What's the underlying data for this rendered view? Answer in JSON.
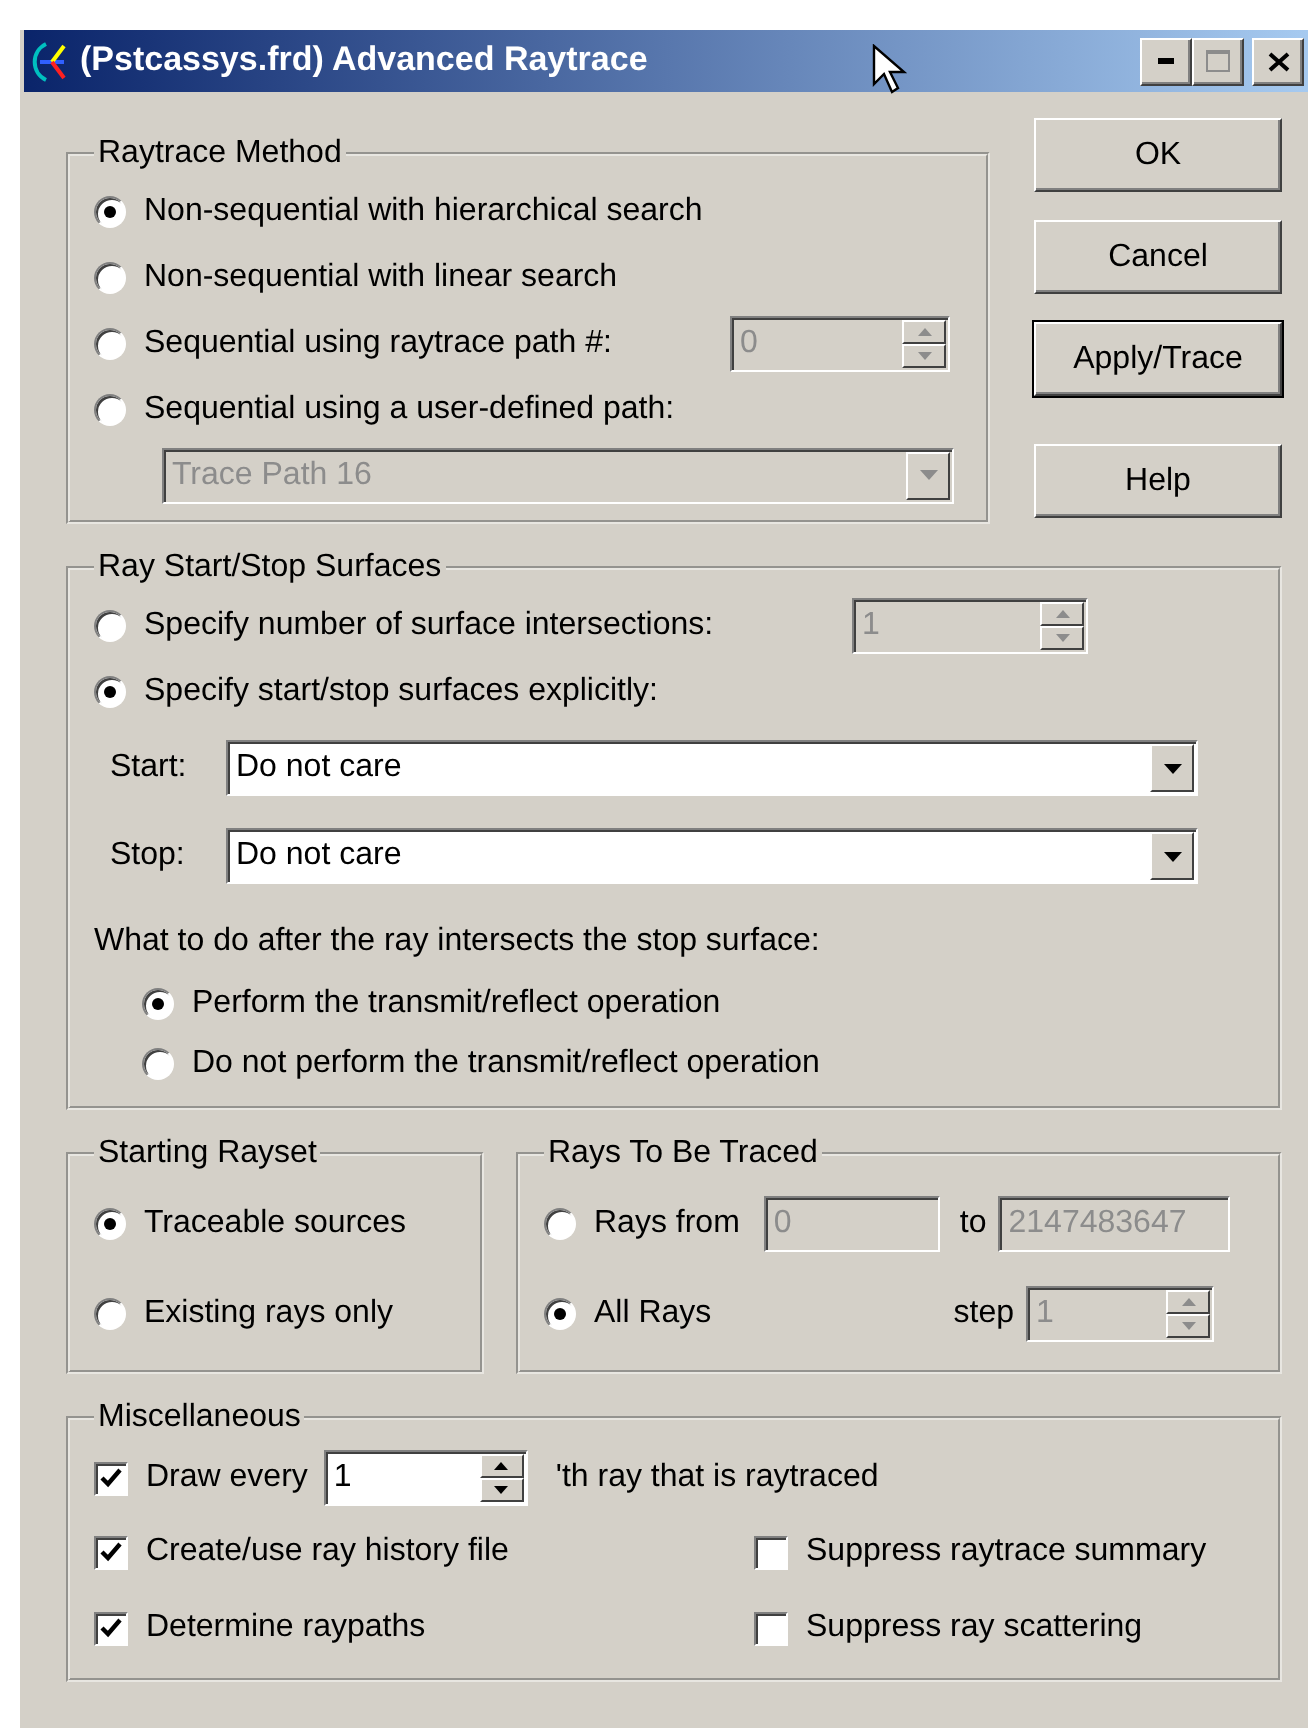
{
  "window": {
    "title": "(Pstcassys.frd) Advanced Raytrace"
  },
  "raytrace_method": {
    "title": "Raytrace Method",
    "options": [
      {
        "label": "Non-sequential with hierarchical search",
        "selected": true
      },
      {
        "label": "Non-sequential with linear search",
        "selected": false
      },
      {
        "label": "Sequential using raytrace path #:",
        "selected": false
      },
      {
        "label": "Sequential using a user-defined path:",
        "selected": false
      }
    ],
    "path_number": {
      "value": "0",
      "disabled": true
    },
    "path_dropdown": {
      "value": "Trace Path 16",
      "disabled": true
    }
  },
  "buttons": [
    {
      "label": "OK",
      "default": false
    },
    {
      "label": "Cancel",
      "default": false
    },
    {
      "label": "Apply/Trace",
      "default": true
    },
    {
      "label": "Help",
      "default": false
    }
  ],
  "ray_start_stop": {
    "title": "Ray Start/Stop Surfaces",
    "options": [
      {
        "label": "Specify number of surface intersections:",
        "selected": false
      },
      {
        "label": "Specify start/stop surfaces explicitly:",
        "selected": true
      }
    ],
    "intersections": {
      "value": "1",
      "disabled": true
    },
    "start": {
      "label": "Start:",
      "value": "Do not care",
      "disabled": false
    },
    "stop": {
      "label": "Stop:",
      "value": "Do not care",
      "disabled": false
    },
    "after_prompt": "What to do after the ray intersects the stop surface:",
    "after_options": [
      {
        "label": "Perform the transmit/reflect operation",
        "selected": true
      },
      {
        "label": "Do not perform the transmit/reflect operation",
        "selected": false
      }
    ]
  },
  "starting_rayset": {
    "title": "Starting Rayset",
    "options": [
      {
        "label": "Traceable sources",
        "selected": true
      },
      {
        "label": "Existing rays only",
        "selected": false
      }
    ]
  },
  "rays_to_be_traced": {
    "title": "Rays To Be Traced",
    "options": [
      {
        "label": "Rays from",
        "selected": false
      },
      {
        "label": "All Rays",
        "selected": true
      }
    ],
    "from": {
      "value": "0",
      "disabled": true
    },
    "to_label": "to",
    "to": {
      "value": "2147483647",
      "disabled": true
    },
    "step_label": "step",
    "step": {
      "value": "1",
      "disabled": true
    }
  },
  "miscellaneous": {
    "title": "Miscellaneous",
    "draw_every": {
      "label": "Draw every",
      "checked": true,
      "value": "1",
      "suffix": "'th ray that is raytraced"
    },
    "options": [
      {
        "label": "Create/use ray history file",
        "checked": true
      },
      {
        "label": "Suppress raytrace summary",
        "checked": false
      },
      {
        "label": "Determine raypaths",
        "checked": true
      },
      {
        "label": "Suppress ray scattering",
        "checked": false
      }
    ]
  }
}
